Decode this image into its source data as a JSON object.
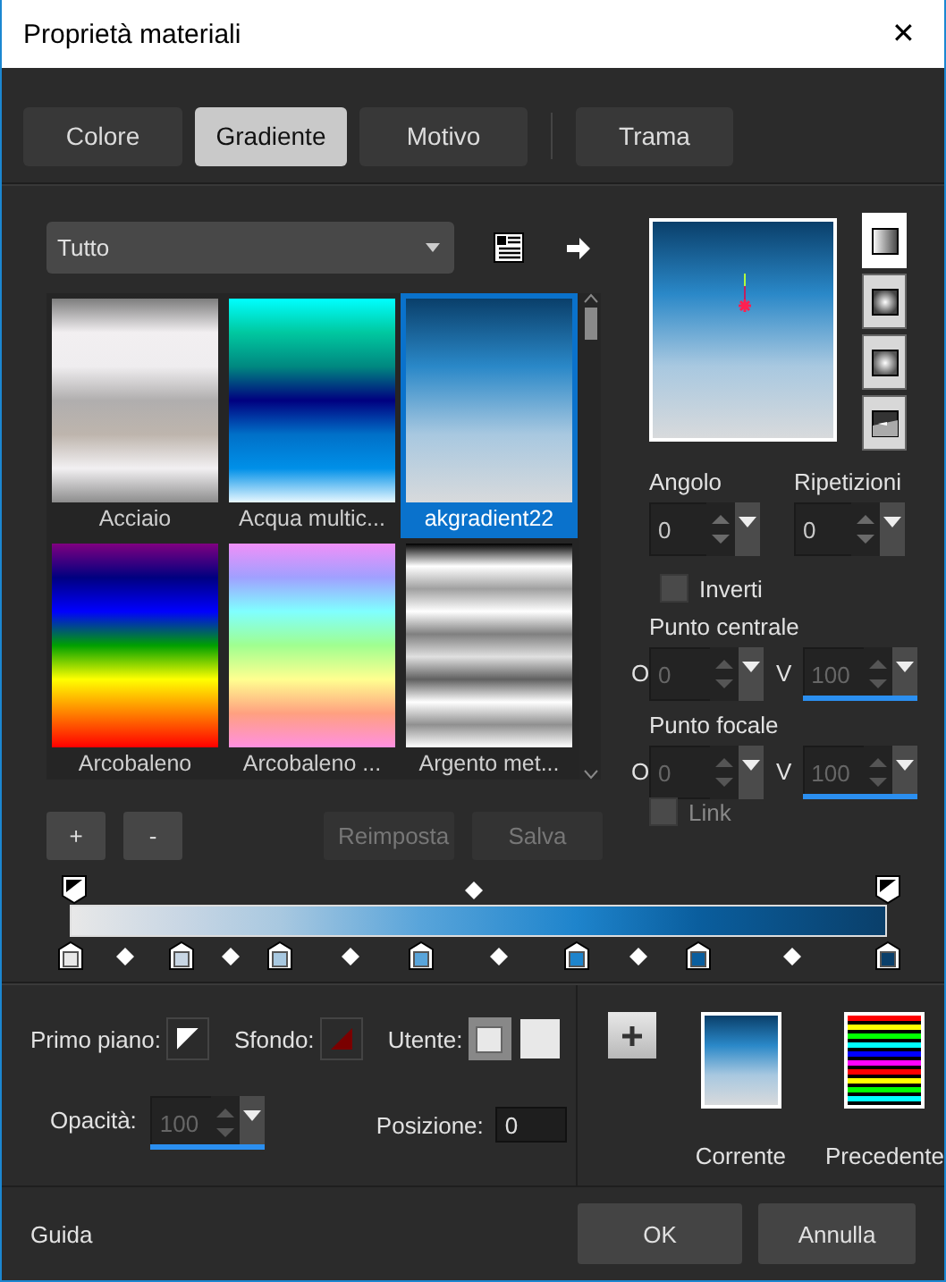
{
  "window": {
    "title": "Proprietà materiali",
    "close": "✕"
  },
  "tabs": [
    {
      "label": "Colore",
      "selected": false
    },
    {
      "label": "Gradiente",
      "selected": true
    },
    {
      "label": "Motivo",
      "selected": false
    },
    {
      "label": "Trama",
      "selected": false
    }
  ],
  "category": {
    "value": "Tutto"
  },
  "gradients": [
    {
      "label": "Acciaio",
      "selected": false
    },
    {
      "label": "Acqua multic...",
      "selected": false
    },
    {
      "label": "akgradient22",
      "selected": true
    },
    {
      "label": "Arcobaleno",
      "selected": false
    },
    {
      "label": "Arcobaleno ...",
      "selected": false
    },
    {
      "label": "Argento met...",
      "selected": false
    }
  ],
  "list_buttons": [
    {
      "label": "+",
      "disabled": false
    },
    {
      "label": "-",
      "disabled": false
    },
    {
      "label": "Reimposta",
      "disabled": true
    },
    {
      "label": "Salva",
      "disabled": true
    }
  ],
  "styles": [
    {
      "kind": "linear",
      "selected": true
    },
    {
      "kind": "rectangular",
      "selected": false
    },
    {
      "kind": "sunburst",
      "selected": false
    },
    {
      "kind": "radial",
      "selected": false
    }
  ],
  "angle": {
    "label": "Angolo",
    "value": "0",
    "disabled": false
  },
  "repeats": {
    "label": "Ripetizioni",
    "value": "0",
    "disabled": false
  },
  "invert": {
    "label": "Inverti",
    "checked": false,
    "disabled": false
  },
  "center_point": {
    "label": "Punto centrale",
    "h_label": "O",
    "h_value": "0",
    "v_label": "V",
    "v_value": "100",
    "disabled": true,
    "level": 1
  },
  "focal_point": {
    "label": "Punto focale",
    "h_label": "O",
    "h_value": "0",
    "v_label": "V",
    "v_value": "100",
    "disabled": true,
    "level": 1
  },
  "link": {
    "label": "Link",
    "checked": false,
    "disabled": true
  },
  "color_stops": [
    {
      "color": "#e8e8e8"
    },
    {
      "color": "#c8d6e4"
    },
    {
      "color": "#a8c8e0"
    },
    {
      "color": "#58a4da"
    },
    {
      "color": "#1e84cc"
    },
    {
      "color": "#0a5e9e"
    },
    {
      "color": "#0a3f6a"
    }
  ],
  "foreground": {
    "label": "Primo piano:"
  },
  "background": {
    "label": "Sfondo:"
  },
  "user": {
    "label": "Utente:"
  },
  "opacity": {
    "label": "Opacità:",
    "value": "100",
    "disabled": true,
    "level": 1
  },
  "position": {
    "label": "Posizione:",
    "value": "0"
  },
  "current": {
    "label": "Corrente"
  },
  "previous": {
    "label": "Precedente"
  },
  "footer": {
    "help": "Guida",
    "ok": "OK",
    "cancel": "Annulla"
  }
}
